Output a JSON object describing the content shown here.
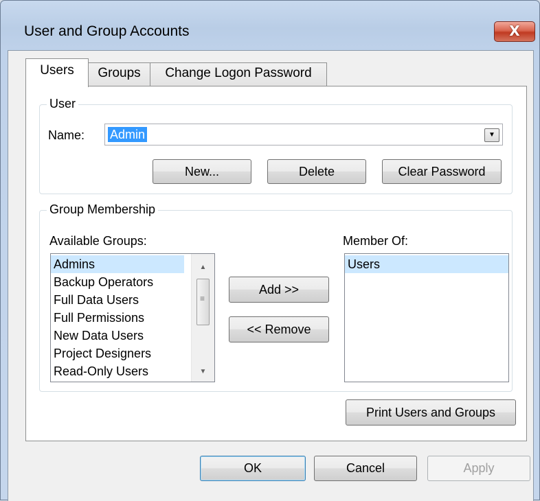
{
  "window": {
    "title": "User and Group Accounts",
    "close_glyph": "X"
  },
  "tabs": [
    {
      "label": "Users"
    },
    {
      "label": "Groups"
    },
    {
      "label": "Change Logon Password"
    }
  ],
  "user_group": {
    "legend": "User",
    "name_label": "Name:",
    "name_value": "Admin",
    "dropdown_glyph": "▼",
    "buttons": {
      "new": "New...",
      "delete": "Delete",
      "clear_password": "Clear Password"
    }
  },
  "membership": {
    "legend": "Group Membership",
    "available_label": "Available Groups:",
    "available_groups": [
      "Admins",
      "Backup Operators",
      "Full Data Users",
      "Full Permissions",
      "New Data Users",
      "Project Designers",
      "Read-Only Users"
    ],
    "member_of_label": "Member Of:",
    "member_of": [
      "Users"
    ],
    "add_button": "Add >>",
    "remove_button": "<< Remove",
    "print_button": "Print Users and Groups",
    "scroll_up_glyph": "▲",
    "scroll_down_glyph": "▼",
    "grip_glyph": "≡"
  },
  "footer": {
    "ok": "OK",
    "cancel": "Cancel",
    "apply": "Apply"
  }
}
